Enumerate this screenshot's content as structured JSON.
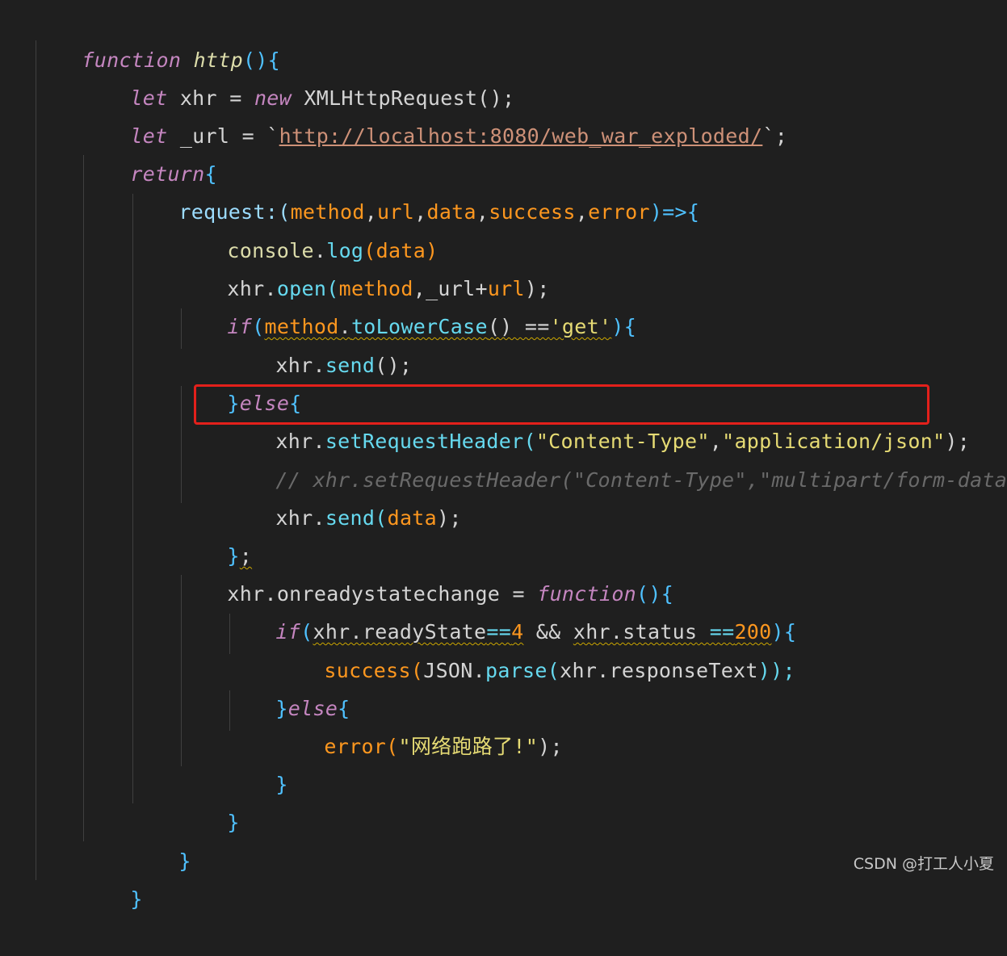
{
  "code": {
    "l1": {
      "kw_function": "function",
      "name": "http",
      "tail": "(){"
    },
    "l2": {
      "kw": "let",
      "var": "xhr",
      "eq": " = ",
      "kw_new": "new",
      "cls": "XMLHttpRequest",
      "tail": "();"
    },
    "l3": {
      "kw": "let",
      "var": "_url",
      "eq": " = `",
      "url": "http://localhost:8080/web_war_exploded/",
      "tail": "`;"
    },
    "l4": {
      "kw": "return",
      "tail": "{"
    },
    "l5": {
      "name": "request",
      "colon": ":(",
      "p1": "method",
      "c1": ",",
      "p2": "url",
      "c2": ",",
      "p3": "data",
      "c3": ",",
      "p4": "success",
      "c4": ",",
      "p5": "error",
      "tail": ")=>{"
    },
    "l6": {
      "obj": "console",
      "dot": ".",
      "fn": "log",
      "open": "(",
      "arg": "data",
      "close": ")"
    },
    "l7": {
      "obj": "xhr",
      "dot": ".",
      "fn": "open",
      "open": "(",
      "a1": "method",
      "comma": ",",
      "a2": "_url",
      "plus": "+",
      "a3": "url",
      "close": ");"
    },
    "l8": {
      "kw": "if",
      "open": "(",
      "a1": "method",
      "dot": ".",
      "fn": "toLowerCase",
      "mid": "() ==",
      "str": "'get'",
      "close": "){"
    },
    "l9": {
      "obj": "xhr",
      "dot": ".",
      "fn": "send",
      "close": "();"
    },
    "l10": {
      "brace": "}",
      "kw": "else",
      "open": "{"
    },
    "l11": {
      "obj": "xhr",
      "dot": ".",
      "fn": "setRequestHeader",
      "open": "(",
      "s1": "\"Content-Type\"",
      "comma": ",",
      "s2": "\"application/json\"",
      "close": ");"
    },
    "l12": {
      "comment": "// xhr.setRequestHeader(\"Content-Type\",\"multipart/form-data\");"
    },
    "l13": {
      "obj": "xhr",
      "dot": ".",
      "fn": "send",
      "open": "(",
      "arg": "data",
      "close": ");"
    },
    "l14": {
      "brace": "}",
      "semi": ";"
    },
    "l15": {
      "obj": "xhr",
      "dot": ".",
      "prop": "onreadystatechange",
      "eq": " = ",
      "kw": "function",
      "tail": "(){"
    },
    "l16": {
      "kw": "if",
      "open": "(",
      "a1": "xhr.readyState",
      "op1": "==",
      "n1": "4",
      "and": " && ",
      "a2": "xhr.status",
      "op2": " ==",
      "n2": "200",
      "close": "){"
    },
    "l17": {
      "fn": "success",
      "open": "(",
      "obj": "JSON",
      "dot": ".",
      "fn2": "parse",
      "open2": "(",
      "arg": "xhr.responseText",
      "close": "));"
    },
    "l18": {
      "brace": "}",
      "kw": "else",
      "open": "{"
    },
    "l19": {
      "fn": "error",
      "open": "(",
      "str": "\"网络跑路了!\"",
      "close": ");"
    },
    "l20": {
      "brace": "}"
    },
    "l21": {
      "brace": "}"
    },
    "l22": {
      "brace": "}"
    },
    "l23": {
      "brace": "}"
    }
  },
  "watermark": "CSDN @打工人小夏",
  "colors": {
    "background": "#1f1f1f",
    "highlight_box": "#e3201b"
  }
}
